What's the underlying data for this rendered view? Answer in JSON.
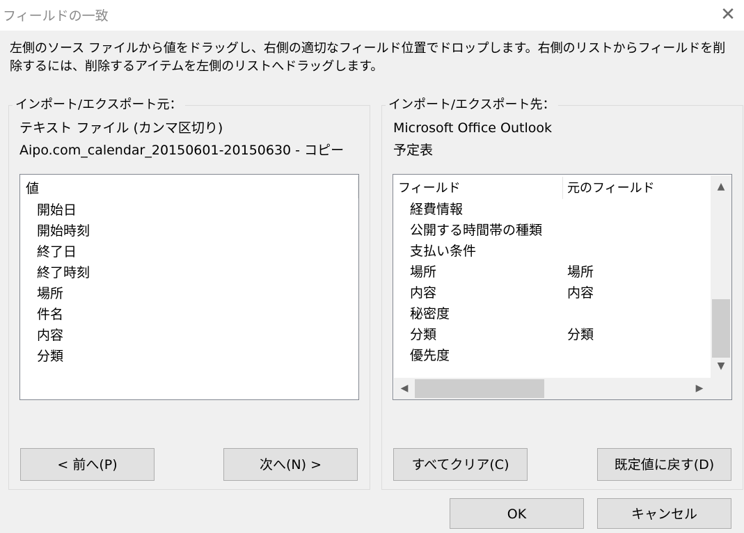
{
  "window": {
    "title": "フィールドの一致",
    "close_glyph": "✕"
  },
  "instruction": "左側のソース ファイルから値をドラッグし、右側の適切なフィールド位置でドロップします。右側のリストからフィールドを削除するには、削除するアイテムを左側のリストへドラッグします。",
  "left": {
    "legend": "インポート/エクスポート元：",
    "source_type": "テキスト ファイル (カンマ区切り)",
    "file_name": "Aipo.com_calendar_20150601-20150630 - コピー",
    "list_header": "値",
    "items": [
      "開始日",
      "開始時刻",
      "終了日",
      "終了時刻",
      "場所",
      "件名",
      "内容",
      "分類"
    ],
    "prev_button": "< 前へ(P)",
    "next_button": "次へ(N) >"
  },
  "right": {
    "legend": "インポート/エクスポート先：",
    "app_name": "Microsoft Office Outlook",
    "folder_name": "予定表",
    "columns": [
      "フィールド",
      "元のフィールド"
    ],
    "rows": [
      {
        "field": "経費情報",
        "source": ""
      },
      {
        "field": "公開する時間帯の種類",
        "source": ""
      },
      {
        "field": "支払い条件",
        "source": ""
      },
      {
        "field": "場所",
        "source": "場所"
      },
      {
        "field": "内容",
        "source": "内容"
      },
      {
        "field": "秘密度",
        "source": ""
      },
      {
        "field": "分類",
        "source": "分類"
      },
      {
        "field": "優先度",
        "source": ""
      }
    ],
    "clear_button": "すべてクリア(C)",
    "default_button": "既定値に戻す(D)"
  },
  "footer": {
    "ok_button": "OK",
    "cancel_button": "キャンセル"
  }
}
